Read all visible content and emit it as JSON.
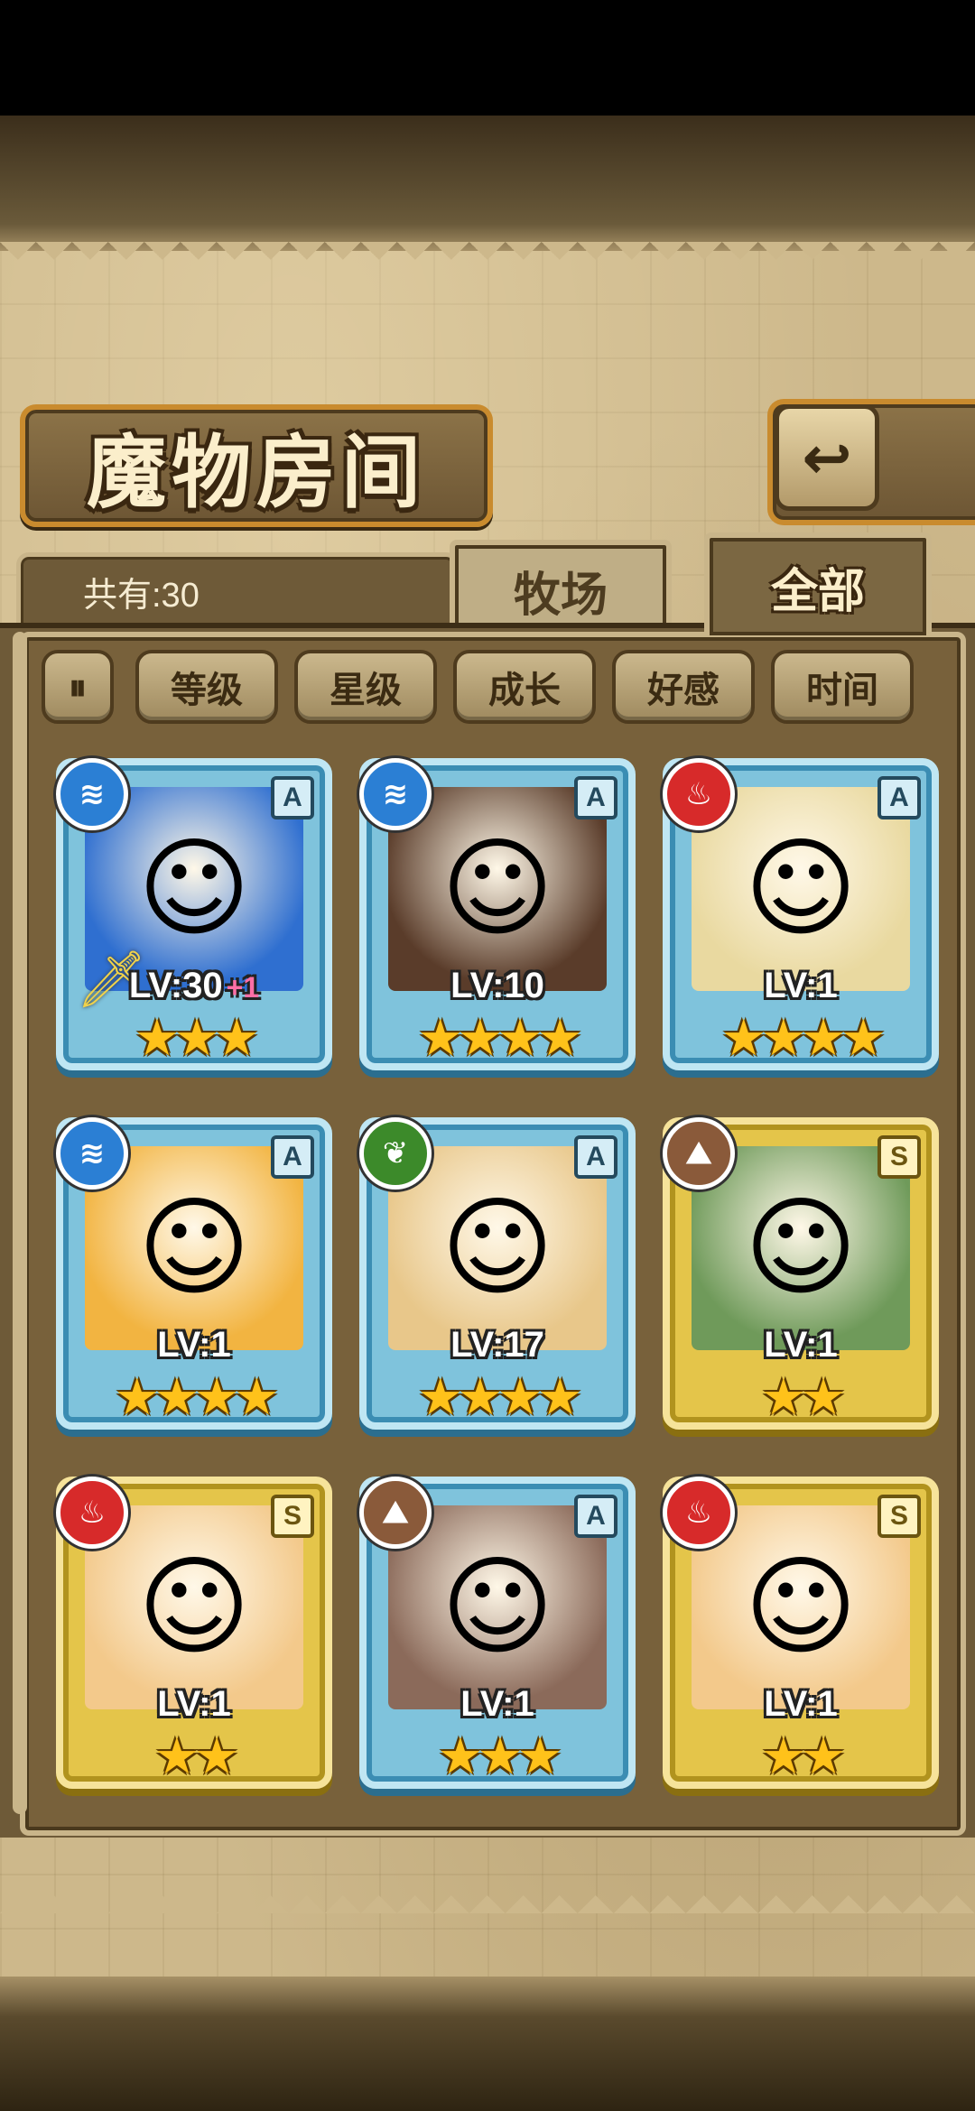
{
  "window": {
    "title": "魔物房间"
  },
  "header": {
    "back_icon": "↩"
  },
  "count": {
    "label": "共有:30"
  },
  "tabs": [
    {
      "label": "牧场",
      "active": false
    },
    {
      "label": "全部",
      "active": true
    }
  ],
  "sort": {
    "toggle_icon": "pause-sort-icon",
    "buttons": [
      "等级",
      "星级",
      "成长",
      "好感",
      "时间"
    ]
  },
  "cards": [
    {
      "rank": "A",
      "element": "water",
      "level": "LV:30",
      "bonus": "+1",
      "stars": "★★★",
      "equipped": true,
      "color": "#2f6fd0"
    },
    {
      "rank": "A",
      "element": "water",
      "level": "LV:10",
      "bonus": "",
      "stars": "★★★★",
      "equipped": false,
      "color": "#5a3c2a"
    },
    {
      "rank": "A",
      "element": "fire",
      "level": "LV:1",
      "bonus": "",
      "stars": "★★★★",
      "equipped": false,
      "color": "#e9d9a0"
    },
    {
      "rank": "A",
      "element": "water",
      "level": "LV:1",
      "bonus": "",
      "stars": "★★★★",
      "equipped": false,
      "color": "#f2b441"
    },
    {
      "rank": "A",
      "element": "wood",
      "level": "LV:17",
      "bonus": "",
      "stars": "★★★★",
      "equipped": false,
      "color": "#e8c78a"
    },
    {
      "rank": "S",
      "element": "earth",
      "level": "LV:1",
      "bonus": "",
      "stars": "★★",
      "equipped": false,
      "color": "#6f9a5a"
    },
    {
      "rank": "S",
      "element": "fire",
      "level": "LV:1",
      "bonus": "",
      "stars": "★★",
      "equipped": false,
      "color": "#f3c98b"
    },
    {
      "rank": "A",
      "element": "earth",
      "level": "LV:1",
      "bonus": "",
      "stars": "★★★",
      "equipped": false,
      "color": "#8b6a5a"
    },
    {
      "rank": "S",
      "element": "fire",
      "level": "LV:1",
      "bonus": "",
      "stars": "★★",
      "equipped": false,
      "color": "#f3c98b"
    }
  ],
  "element_colors": {
    "water": "#2b7fd4",
    "fire": "#d72a2a",
    "wood": "#3c8a2a",
    "earth": "#8a5a3a"
  },
  "element_glyphs": {
    "water": "≋",
    "fire": "♨",
    "wood": "❦",
    "earth": "⛰"
  }
}
